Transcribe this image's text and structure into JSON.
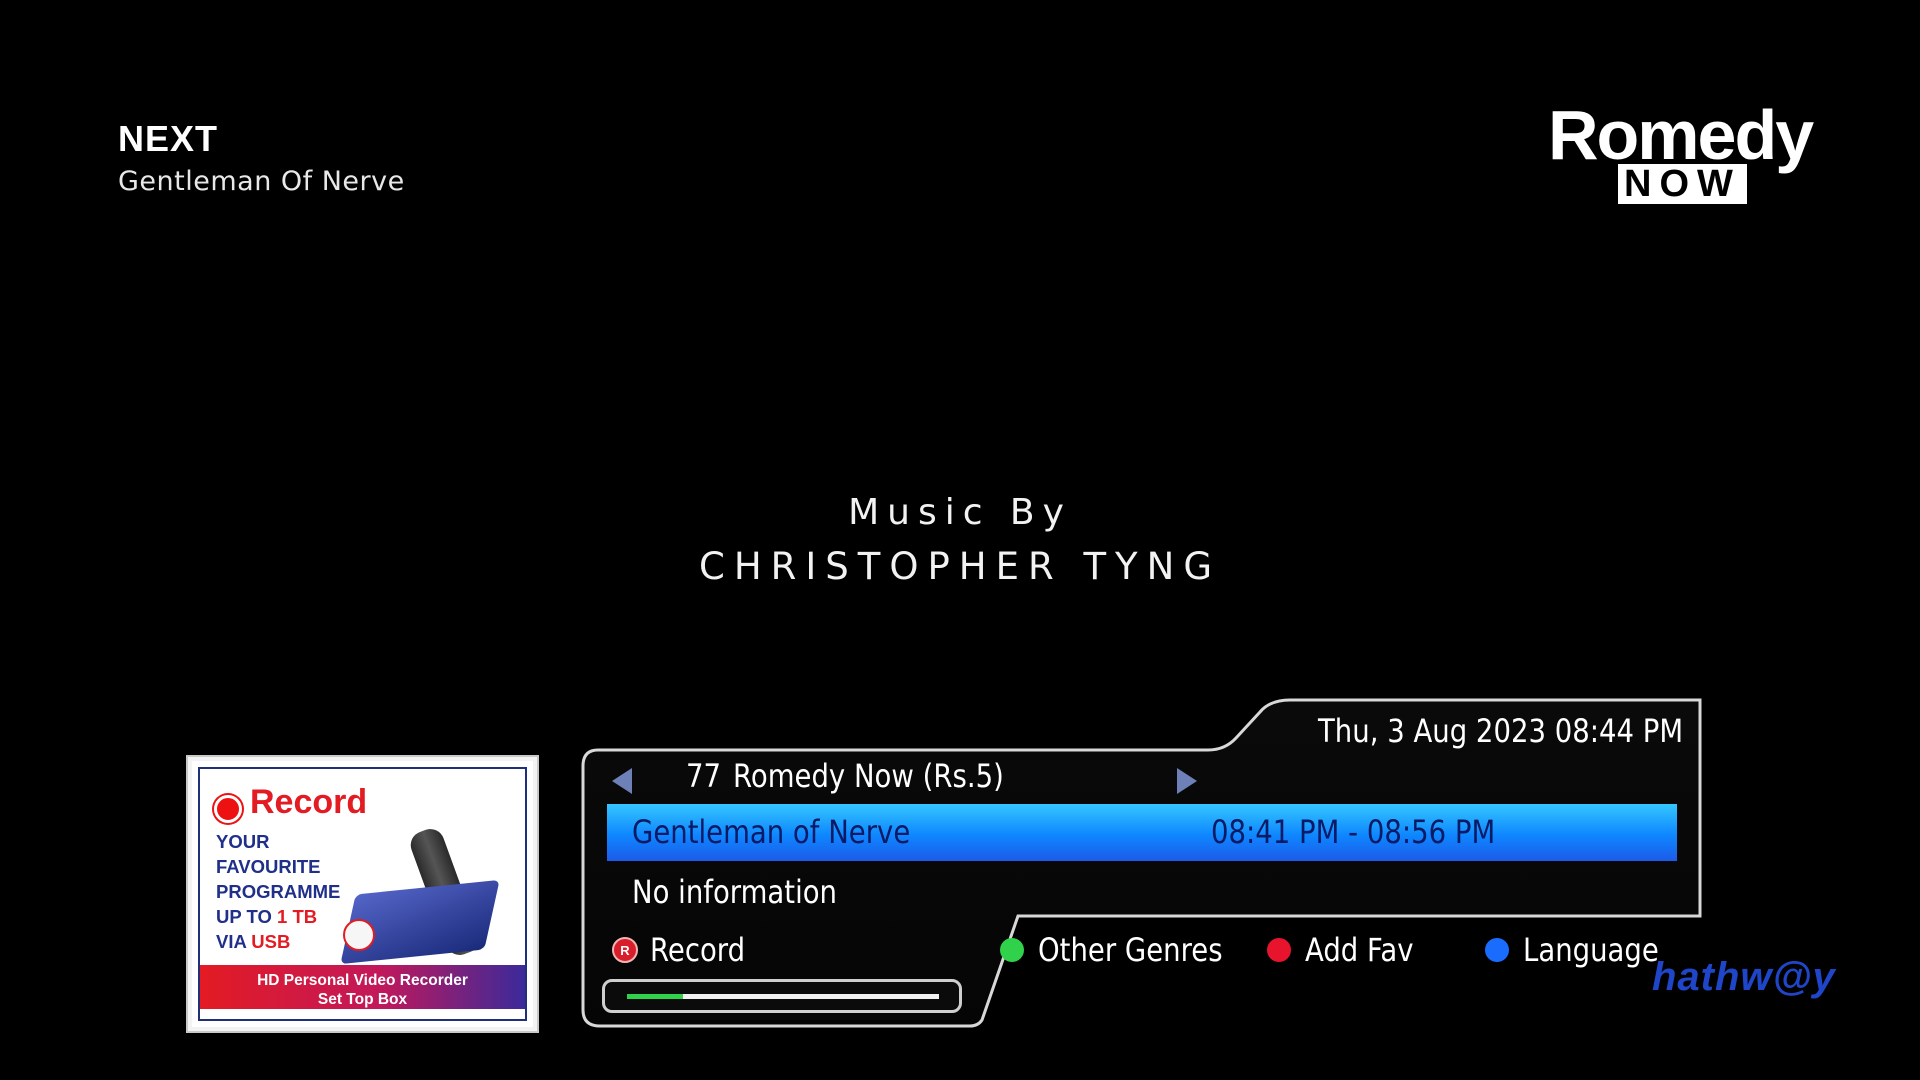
{
  "next": {
    "label": "NEXT",
    "title": "Gentleman Of Nerve"
  },
  "channel_logo": {
    "top": "Romedy",
    "bottom": "NOW"
  },
  "on_screen": {
    "line1": "Music By",
    "line2": "CHRISTOPHER TYNG"
  },
  "ad": {
    "headline": "Record",
    "lines": [
      "YOUR",
      "FAVOURITE",
      "PROGRAMME"
    ],
    "line4_prefix": "UP TO ",
    "line4_highlight": "1 TB",
    "line5_prefix": "VIA ",
    "line5_highlight": "USB",
    "footer_line1": "HD Personal Video Recorder",
    "footer_line2": "Set Top Box"
  },
  "info_panel": {
    "datetime": "Thu, 3 Aug 2023 08:44 PM",
    "channel_number": "77",
    "channel_name": "Romedy Now (Rs.5)",
    "program_title": "Gentleman of Nerve",
    "program_time": "08:41 PM - 08:56 PM",
    "program_info": "No information",
    "progress_fraction": 0.18
  },
  "legend": {
    "record_badge": "R",
    "record": "Record",
    "green": "Other Genres",
    "red": "Add Fav",
    "blue": "Language"
  },
  "colors": {
    "highlight_bar": "#1a8cff",
    "green": "#2fd24a",
    "red": "#e8142d",
    "blue": "#1a6cff"
  },
  "provider_logo": "hathw@y"
}
